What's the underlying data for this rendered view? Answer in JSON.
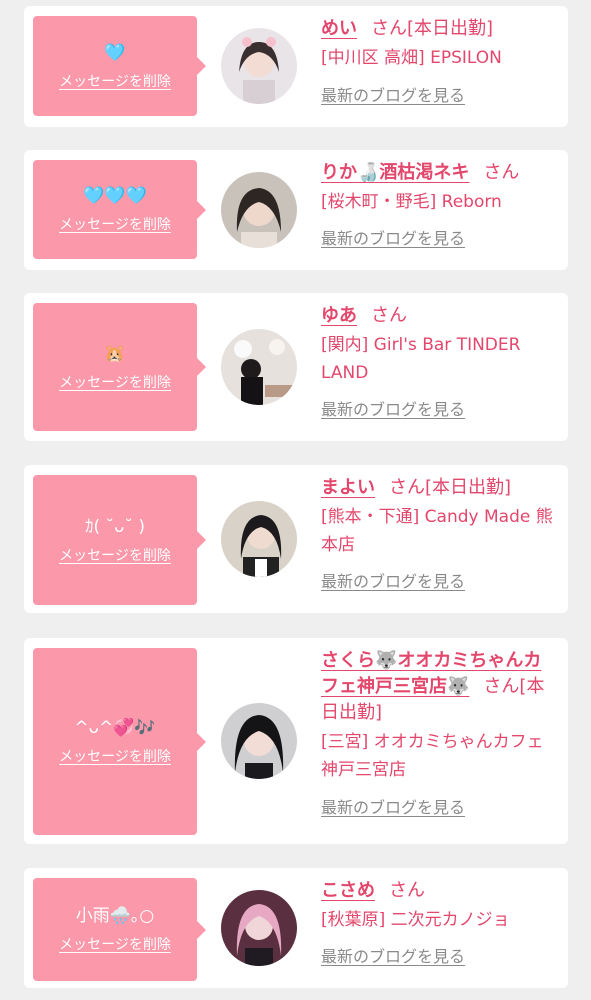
{
  "colors": {
    "background": "#efefef",
    "card": "#ffffff",
    "bubble": "#fb98aa",
    "name": "#e3476c",
    "link_gray": "#8a8a8a"
  },
  "delete_label": "メッセージを削除",
  "blog_label": "最新のブログを見る",
  "entries": [
    {
      "message": "🩵",
      "name": "めい",
      "suffix": "さん",
      "status": "[本日出勤]",
      "shop": "[中川区 高畑] EPSILON"
    },
    {
      "message": "🩵🩵🩵",
      "name": "りか🍶酒枯渇ネキ",
      "suffix": "さん",
      "status": "",
      "shop": "[桜木町・野毛] Reborn"
    },
    {
      "message": "🐹",
      "name": "ゆあ",
      "suffix": "さん",
      "status": "",
      "shop": "[関内] Girl's Bar TINDER LAND"
    },
    {
      "message": "ｶ( ˘ᴗ˘ )",
      "name": "まよい",
      "suffix": "さん",
      "status": "[本日出勤]",
      "shop": "[熊本・下通] Candy Made 熊本店"
    },
    {
      "message": "^ᴗ^💞🎶",
      "name": "さくら🐺オオカミちゃんカフェ神戸三宮店🐺",
      "suffix": "さん",
      "status": "[本日出勤]",
      "shop": "[三宮] オオカミちゃんカフェ神戸三宮店"
    },
    {
      "message": "小雨🌧️｡○",
      "name": "こさめ",
      "suffix": "さん",
      "status": "",
      "shop": "[秋葉原] 二次元カノジョ"
    }
  ]
}
